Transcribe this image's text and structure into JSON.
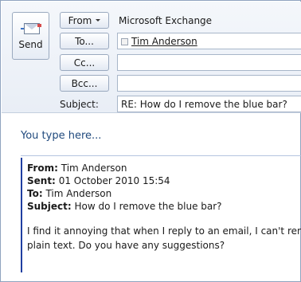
{
  "header": {
    "send_label": "Send",
    "from_label": "From",
    "account": "Microsoft Exchange",
    "to_label": "To...",
    "to_recipient": "Tim Anderson",
    "cc_label": "Cc...",
    "bcc_label": "Bcc...",
    "subject_label": "Subject:",
    "subject_value": "RE: How do I remove the blue bar?"
  },
  "body": {
    "you_type": "You type here...",
    "quote": {
      "from_key": "From:",
      "from_val": "Tim Anderson",
      "sent_key": "Sent:",
      "sent_val": "01 October 2010 15:54",
      "to_key": "To:",
      "to_val": "Tim Anderson",
      "subject_key": "Subject:",
      "subject_val": "How do I remove the blue bar?",
      "para_line1": "I find it annoying that when I reply to an email, I can't ren",
      "para_line2": "plain text. Do you have any suggestions?"
    }
  },
  "icons": {
    "send": "send-envelope-icon",
    "from_dropdown": "chevron-down-icon",
    "recipient": "contact-checkbox-icon"
  }
}
